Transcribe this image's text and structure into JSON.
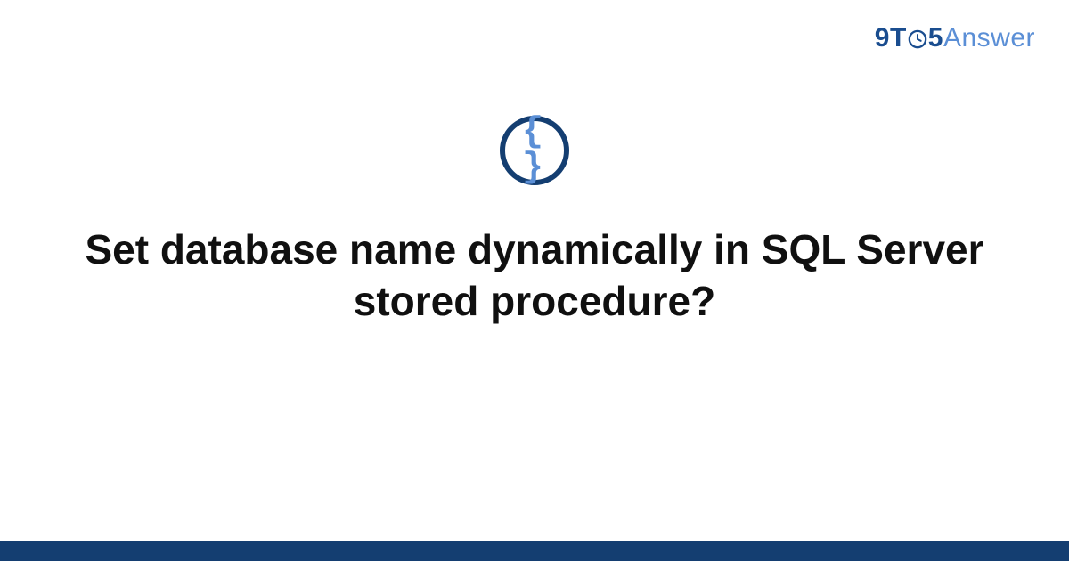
{
  "brand": {
    "prefix_nine": "9",
    "prefix_t": "T",
    "five": "5",
    "suffix": "Answer",
    "clock_icon": "clock-icon"
  },
  "badge": {
    "symbol": "{ }"
  },
  "question": {
    "title": "Set database name dynamically in SQL Server stored procedure?"
  },
  "colors": {
    "brand_dark": "#143e71",
    "brand_light": "#5b8fd6",
    "text": "#101010",
    "background": "#ffffff"
  }
}
